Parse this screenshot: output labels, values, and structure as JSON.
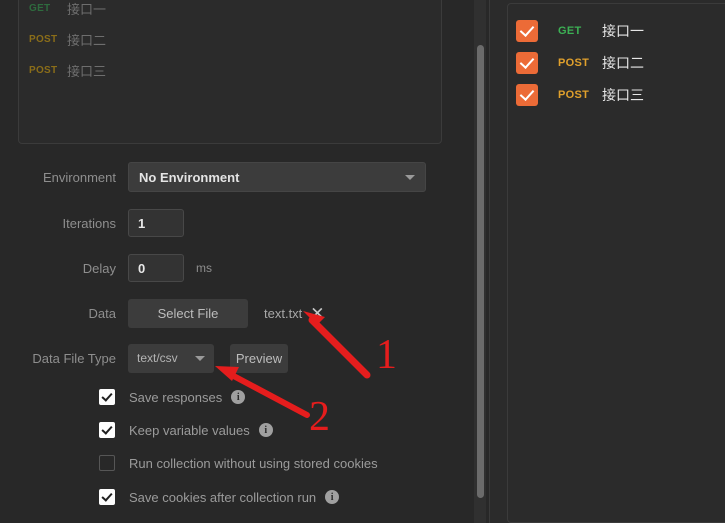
{
  "request_list": {
    "rows": [
      {
        "method": "GET",
        "name": "接口一"
      },
      {
        "method": "POST",
        "name": "接口二"
      },
      {
        "method": "POST",
        "name": "接口三"
      }
    ]
  },
  "form": {
    "environment": {
      "label": "Environment",
      "value": "No Environment",
      "caret_icon": "chevron-down-icon"
    },
    "iterations": {
      "label": "Iterations",
      "value": "1"
    },
    "delay": {
      "label": "Delay",
      "value": "0",
      "unit": "ms"
    },
    "data": {
      "label": "Data",
      "select_file_label": "Select File",
      "filename": "text.txt",
      "clear_icon": "✕"
    },
    "data_file_type": {
      "label": "Data File Type",
      "value": "text/csv",
      "caret_icon": "chevron-down-icon",
      "preview_label": "Preview"
    },
    "options": [
      {
        "label": "Save responses",
        "checked": true,
        "info": true,
        "info_glyph": "i"
      },
      {
        "label": "Keep variable values",
        "checked": true,
        "info": true,
        "info_glyph": "i"
      },
      {
        "label": "Run collection without using stored cookies",
        "checked": false,
        "info": false,
        "info_glyph": "i"
      },
      {
        "label": "Save cookies after collection run",
        "checked": true,
        "info": true,
        "info_glyph": "i"
      }
    ]
  },
  "selection_panel": {
    "rows": [
      {
        "checked": true,
        "method": "GET",
        "name": "接口一"
      },
      {
        "checked": true,
        "method": "POST",
        "name": "接口二"
      },
      {
        "checked": true,
        "method": "POST",
        "name": "接口三"
      }
    ]
  },
  "annotations": {
    "markers": [
      {
        "number": "1"
      },
      {
        "number": "2"
      }
    ],
    "color": "#e51d1d"
  },
  "colors": {
    "background": "#282828",
    "panel": "#2b2b2b",
    "accent_orange": "#ec6b37",
    "method_get": "#3cb054",
    "method_post": "#e0a02c",
    "annotation_red": "#e51d1d"
  }
}
